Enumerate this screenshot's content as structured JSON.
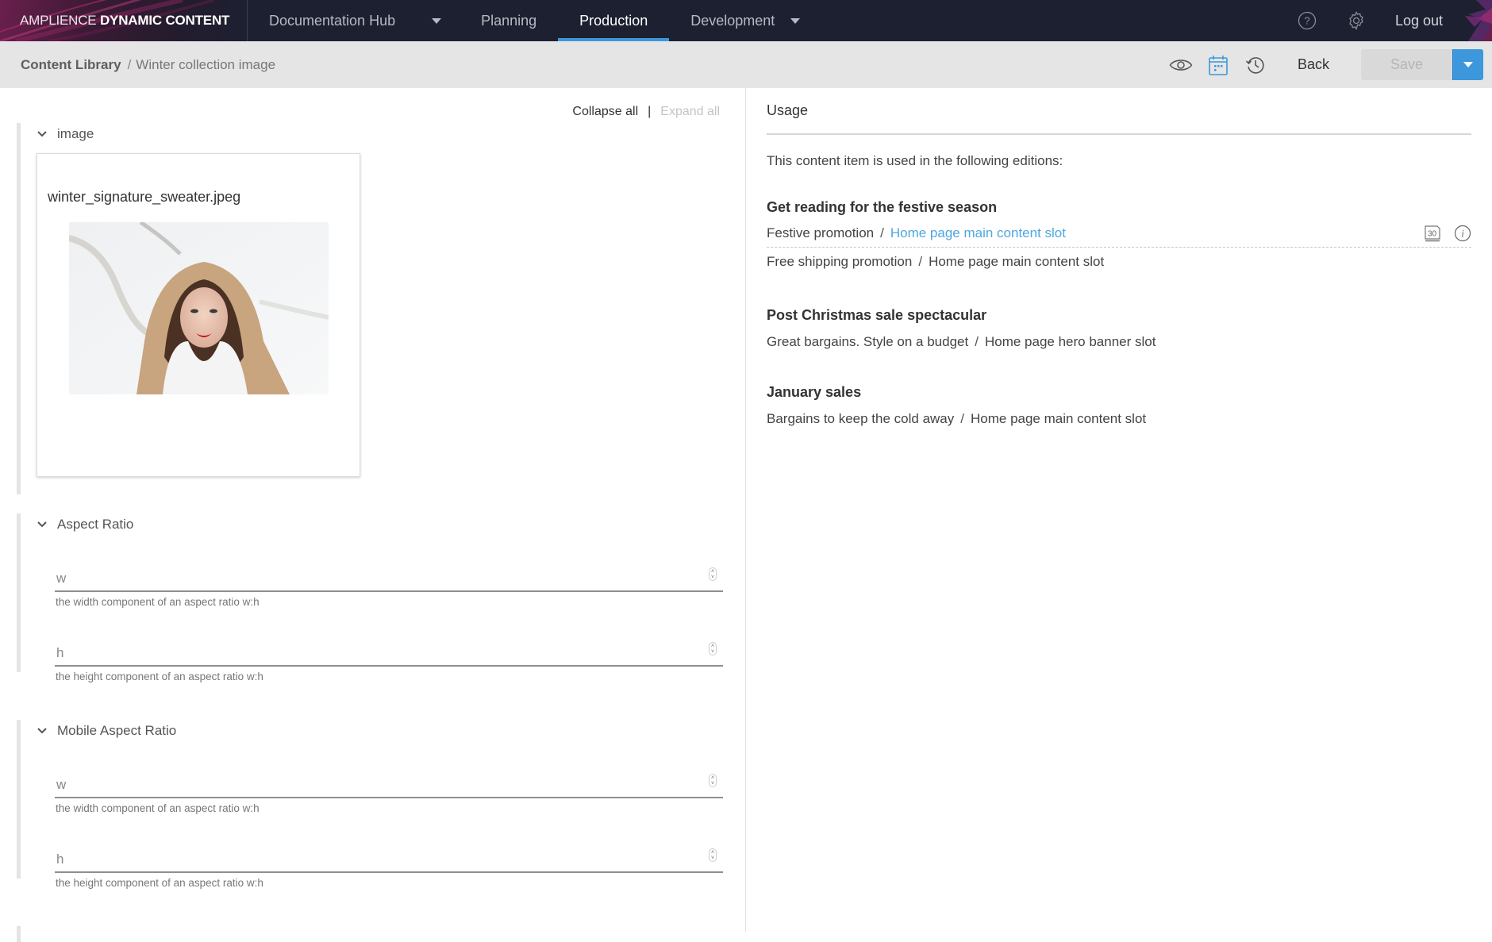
{
  "app": {
    "brand_light": "AMPLIENCE",
    "brand_bold": "DYNAMIC CONTENT",
    "hub": "Documentation Hub",
    "nav": [
      {
        "label": "Planning",
        "active": false
      },
      {
        "label": "Production",
        "active": true
      },
      {
        "label": "Development",
        "active": false
      }
    ],
    "logout": "Log out",
    "accent": "#3c97dd",
    "nav_bg": "#1c2030"
  },
  "toolbar": {
    "breadcrumb_root": "Content Library",
    "breadcrumb_sep": "/",
    "breadcrumb_current": "Winter collection image",
    "back_label": "Back",
    "save_label": "Save"
  },
  "editor": {
    "collapse_all": "Collapse all",
    "divider": "|",
    "expand_all": "Expand all",
    "image_section": {
      "title": "image",
      "filename": "winter_signature_sweater.jpeg"
    },
    "aspect_ratio": {
      "title": "Aspect Ratio",
      "w_label": "w",
      "w_help": "the width component of an aspect ratio w:h",
      "h_label": "h",
      "h_help": "the height component of an aspect ratio w:h"
    },
    "mobile_aspect_ratio": {
      "title": "Mobile Aspect Ratio",
      "w_label": "w",
      "w_help": "the width component of an aspect ratio w:h",
      "h_label": "h",
      "h_help": "the height component of an aspect ratio w:h"
    }
  },
  "usage": {
    "title": "Usage",
    "intro": "This content item is used in the following editions:",
    "editions": [
      {
        "title": "Get reading for the festive season",
        "slots": [
          {
            "promotion": "Festive promotion",
            "slot": "Home page main content slot",
            "highlighted": true,
            "calendar_day": "30"
          },
          {
            "promotion": "Free shipping promotion",
            "slot": "Home page main content slot",
            "highlighted": false
          }
        ]
      },
      {
        "title": "Post Christmas sale spectacular",
        "slots": [
          {
            "promotion": "Great bargains. Style on a budget",
            "slot": "Home page hero banner slot",
            "highlighted": false
          }
        ]
      },
      {
        "title": "January sales",
        "slots": [
          {
            "promotion": "Bargains to keep the cold away",
            "slot": "Home page main content slot",
            "highlighted": false
          }
        ]
      }
    ],
    "sep": "/"
  }
}
